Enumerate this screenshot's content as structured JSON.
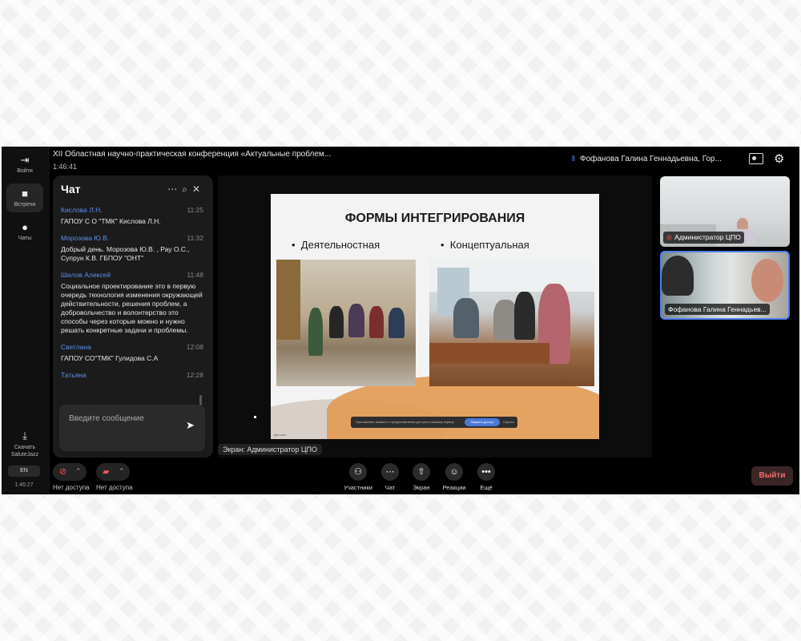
{
  "header": {
    "conference_title": "XII Областная научно-практическая конференция «Актуальные проблем...",
    "elapsed": "1:46:41",
    "speaker": "Фофанова Галина Геннадьевна, Гор..."
  },
  "rail": {
    "items": [
      {
        "icon": "exit-icon",
        "label": "Войти"
      },
      {
        "icon": "camera-icon",
        "label": "Встречи"
      },
      {
        "icon": "chat-icon",
        "label": "Чаты"
      }
    ],
    "download_label": "Скачать SaluteJazz",
    "language": "EN",
    "clock": "1:46:27"
  },
  "chat": {
    "title": "Чат",
    "messages": [
      {
        "author": "Кислова Л.Н.",
        "time": "11:25",
        "text": "ГАПОУ С О \"ТМК\" Кислова Л.Н."
      },
      {
        "author": "Морозова Ю.В.",
        "time": "11:32",
        "text": "Добрый день. Морозова Ю.В. , Рау О.С., Супрун К.В. ГБПОУ \"ОНТ\""
      },
      {
        "author": "Шилов Алексей",
        "time": "11:48",
        "text": "Социальное проектирование это в первую очередь технология изменения окружающей действительности, решения проблем, а добровольчество и волонтерство это способы через которые можно и нужно решать конкретные задачи и проблемы."
      },
      {
        "author": "Светлана",
        "time": "12:08",
        "text": "ГАПОУ СО\"ТМК\" Гулидова С.А"
      },
      {
        "author": "Татьяна",
        "time": "12:28",
        "text": ""
      }
    ],
    "input_placeholder": "Введите сообщение"
  },
  "slide": {
    "title": "ФОРМЫ ИНТЕГРИРОВАНИЯ",
    "bullets": [
      "Деятельностная",
      "Концептуальная"
    ],
    "footer": "fppt.com",
    "share_bar": {
      "text": "Приложение заявило о предоставлении доступа к вашему экрану",
      "button": "Закрыть доступ",
      "cancel": "Скрыть"
    }
  },
  "screen_label": "Экран: Администратор ЦПО",
  "tiles": [
    {
      "name": "Администратор ЦПО",
      "muted": true
    },
    {
      "name": "Фофанова Галина Геннадьев...",
      "muted": false
    }
  ],
  "controls": {
    "mic_label": "Нет доступа",
    "camera_label": "Нет доступа",
    "items": [
      {
        "icon": "participants-icon",
        "label": "Участники"
      },
      {
        "icon": "chat-icon",
        "label": "Чат"
      },
      {
        "icon": "screen-share-icon",
        "label": "Экран"
      },
      {
        "icon": "reactions-icon",
        "label": "Реакции"
      },
      {
        "icon": "more-icon",
        "label": "Ещё"
      }
    ],
    "exit_label": "Выйти"
  },
  "colors": {
    "accent": "#5b8ff0",
    "danger": "#f26b6b",
    "background": "#000000"
  }
}
